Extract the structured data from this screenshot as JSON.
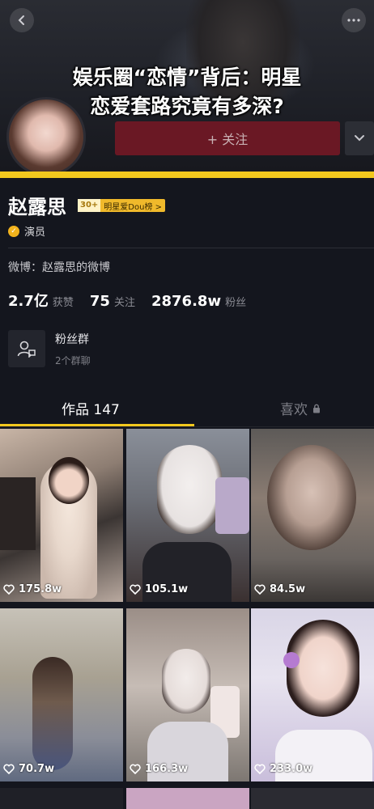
{
  "headline": {
    "line1": "娱乐圈“恋情”背后：明星",
    "line2": "恋爱套路究竟有多深?"
  },
  "header": {
    "follow_label": "+ 关注"
  },
  "profile": {
    "name": "赵露思",
    "rank_badge": {
      "level": "30+",
      "label": "明星爱Dou榜 >"
    },
    "verified_role": "演员",
    "weibo_label": "微博：赵露思的微博",
    "stats": [
      {
        "value": "2.7亿",
        "label": "获赞"
      },
      {
        "value": "75",
        "label": "关注"
      },
      {
        "value": "2876.8w",
        "label": "粉丝"
      }
    ],
    "fans_group": {
      "title": "粉丝群",
      "subtitle": "2个群聊"
    }
  },
  "tabs": {
    "works": "作品 147",
    "likes": "喜欢"
  },
  "videos": [
    {
      "likes": "175.8w"
    },
    {
      "likes": "105.1w"
    },
    {
      "likes": "84.5w"
    },
    {
      "likes": "70.7w"
    },
    {
      "likes": "166.3w"
    },
    {
      "likes": "233.0w"
    }
  ],
  "colors": {
    "accent": "#f2c81e",
    "follow_bg": "#6a1824",
    "background": "#14161e"
  },
  "icons": {
    "back": "chevron-left-icon",
    "more": "more-dots-icon",
    "dropdown": "chevron-down-icon",
    "verified": "verified-check-icon",
    "fans_group": "group-chat-icon",
    "lock": "lock-icon",
    "heart": "heart-outline-icon"
  }
}
